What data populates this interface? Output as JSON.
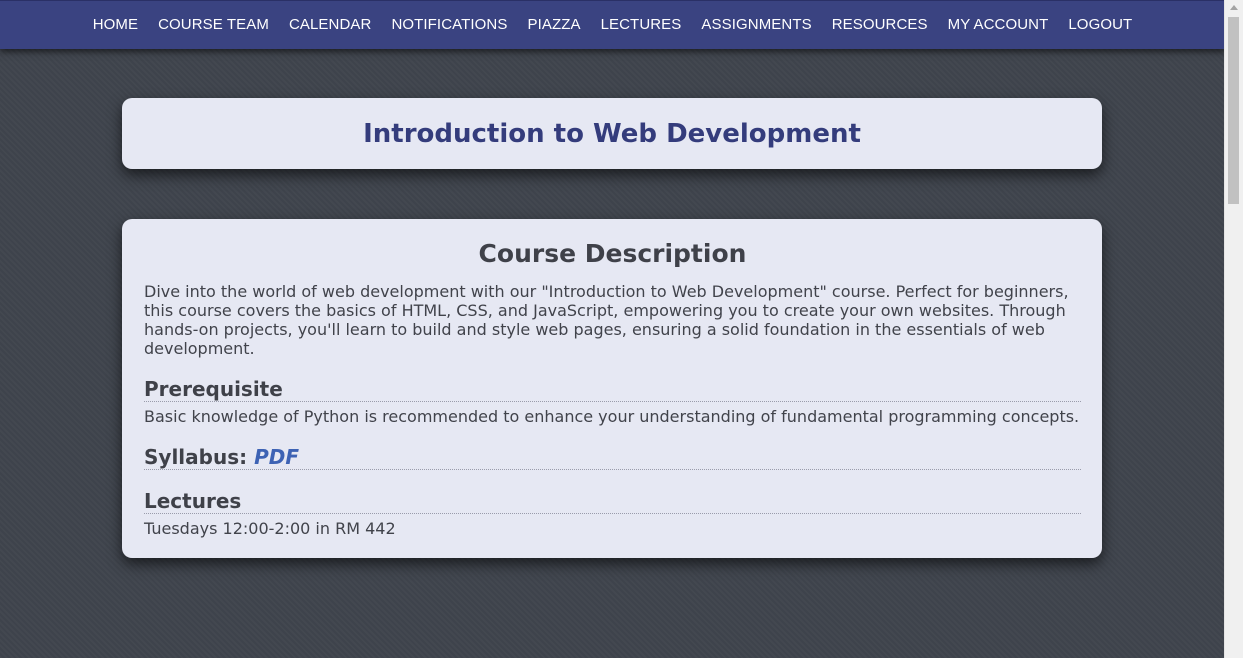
{
  "nav": {
    "items": [
      {
        "label": "HOME"
      },
      {
        "label": "COURSE TEAM"
      },
      {
        "label": "CALENDAR"
      },
      {
        "label": "NOTIFICATIONS"
      },
      {
        "label": "PIAZZA"
      },
      {
        "label": "LECTURES"
      },
      {
        "label": "ASSIGNMENTS"
      },
      {
        "label": "RESOURCES"
      },
      {
        "label": "MY ACCOUNT"
      },
      {
        "label": "LOGOUT"
      }
    ]
  },
  "header": {
    "title": "Introduction to Web Development"
  },
  "course": {
    "heading": "Course Description",
    "description": "Dive into the world of web development with our \"Introduction to Web Development\" course. Perfect for beginners, this course covers the basics of HTML, CSS, and JavaScript, empowering you to create your own websites. Through hands-on projects, you'll learn to build and style web pages, ensuring a solid foundation in the essentials of web development.",
    "prerequisite": {
      "heading": "Prerequisite",
      "text": "Basic knowledge of Python is recommended to enhance your understanding of fundamental programming concepts."
    },
    "syllabus": {
      "heading": "Syllabus: ",
      "link_label": "PDF"
    },
    "lectures": {
      "heading": "Lectures",
      "text": "Tuesdays 12:00-2:00 in RM 442"
    }
  }
}
